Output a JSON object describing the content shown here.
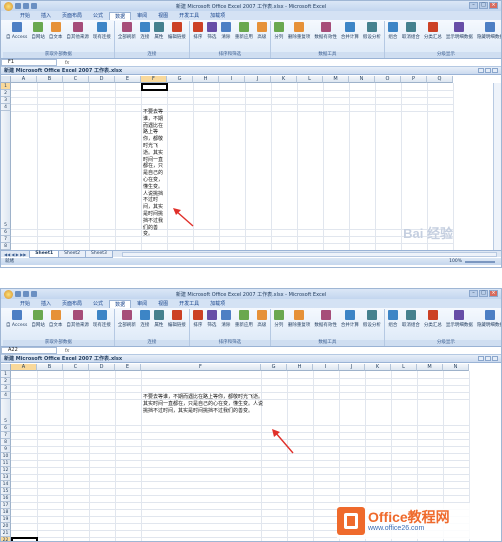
{
  "shots": [
    {
      "window_title": "新建 Microsoft Office Excel 2007 工作表.xlsx - Microsoft Excel",
      "tabs": [
        "开始",
        "插入",
        "页面布局",
        "公式",
        "数据",
        "审阅",
        "视图",
        "开发工具",
        "加载项"
      ],
      "active_tab": "数据",
      "ribbon_groups": [
        {
          "name": "获取外部数据",
          "buttons": [
            "自 Access",
            "自网站",
            "自文本",
            "自其他来源",
            "现有连接"
          ]
        },
        {
          "name": "连接",
          "buttons": [
            "全部刷新",
            "连接",
            "属性",
            "编辑链接"
          ]
        },
        {
          "name": "排序和筛选",
          "buttons": [
            "排序",
            "筛选",
            "清除",
            "重新应用",
            "高级"
          ]
        },
        {
          "name": "数据工具",
          "buttons": [
            "分列",
            "删除重复项",
            "数据有效性",
            "合并计算",
            "假设分析"
          ]
        },
        {
          "name": "分级显示",
          "buttons": [
            "组合",
            "取消组合",
            "分类汇总",
            "显示明细数据",
            "隐藏明细数据"
          ]
        }
      ],
      "name_box": "F1",
      "formula_fx": "fx",
      "doc_title": "新建 Microsoft Office Excel 2007 工作表.xlsx",
      "columns": [
        "A",
        "B",
        "C",
        "D",
        "E",
        "F",
        "G",
        "H",
        "I",
        "J",
        "K",
        "L",
        "M",
        "N",
        "O",
        "P",
        "Q"
      ],
      "selected_column": "F",
      "rows": [
        "1",
        "2",
        "3",
        "4",
        "5",
        "6",
        "7",
        "8"
      ],
      "selected_row": "1",
      "cell_text": "不要去等谁，不期而遇比在路上等你，都敬时光飞逝。其实时间一直都在，只是自己的心在变，懂生变。人说挑挡不过时间，其实是时间挑挡不过我们的善变。",
      "sheets": [
        "Sheet1",
        "Sheet2",
        "Sheet3"
      ],
      "active_sheet": "Sheet1",
      "status": "就绪",
      "zoom": "100%",
      "watermark": "Bai 经验"
    },
    {
      "window_title": "新建 Microsoft Office Excel 2007 工作表.xlsx - Microsoft Excel",
      "tabs": [
        "开始",
        "插入",
        "页面布局",
        "公式",
        "数据",
        "审阅",
        "视图",
        "开发工具",
        "加载项"
      ],
      "active_tab": "数据",
      "ribbon_groups": [
        {
          "name": "获取外部数据",
          "buttons": [
            "自 Access",
            "自网站",
            "自文本",
            "自其他来源",
            "现有连接"
          ]
        },
        {
          "name": "连接",
          "buttons": [
            "全部刷新",
            "连接",
            "属性",
            "编辑链接"
          ]
        },
        {
          "name": "排序和筛选",
          "buttons": [
            "排序",
            "筛选",
            "清除",
            "重新应用",
            "高级"
          ]
        },
        {
          "name": "数据工具",
          "buttons": [
            "分列",
            "删除重复项",
            "数据有效性",
            "合并计算",
            "假设分析"
          ]
        },
        {
          "name": "分级显示",
          "buttons": [
            "组合",
            "取消组合",
            "分类汇总",
            "显示明细数据",
            "隐藏明细数据"
          ]
        }
      ],
      "name_box": "A22",
      "formula_fx": "fx",
      "doc_title": "新建 Microsoft Office Excel 2007 工作表.xlsx",
      "columns": [
        "A",
        "B",
        "C",
        "D",
        "E",
        "F",
        "G",
        "H",
        "I",
        "J",
        "K",
        "L",
        "M",
        "N"
      ],
      "selected_column": "A",
      "rows": [
        "1",
        "2",
        "3",
        "4",
        "5",
        "6",
        "7",
        "8",
        "9",
        "10",
        "11",
        "12",
        "13",
        "14",
        "15",
        "16",
        "17",
        "18",
        "19",
        "20",
        "21",
        "22"
      ],
      "selected_row": "22",
      "cell_text": "不要去等谁，不期而遇比在路上等你，都敬时光飞逝。其实时间一直都在，只是自己的心在变，懂生变。人说挑挡不过时间，其实是时间挑挡不过我们的善变。"
    }
  ],
  "logo": {
    "name": "Office教程网",
    "url": "www.office26.com"
  },
  "colors": {
    "accent": "#ef6a2c",
    "ribbon": "#dbe8f7",
    "arrow": "#e0302a",
    "url": "#3b6fb6"
  }
}
